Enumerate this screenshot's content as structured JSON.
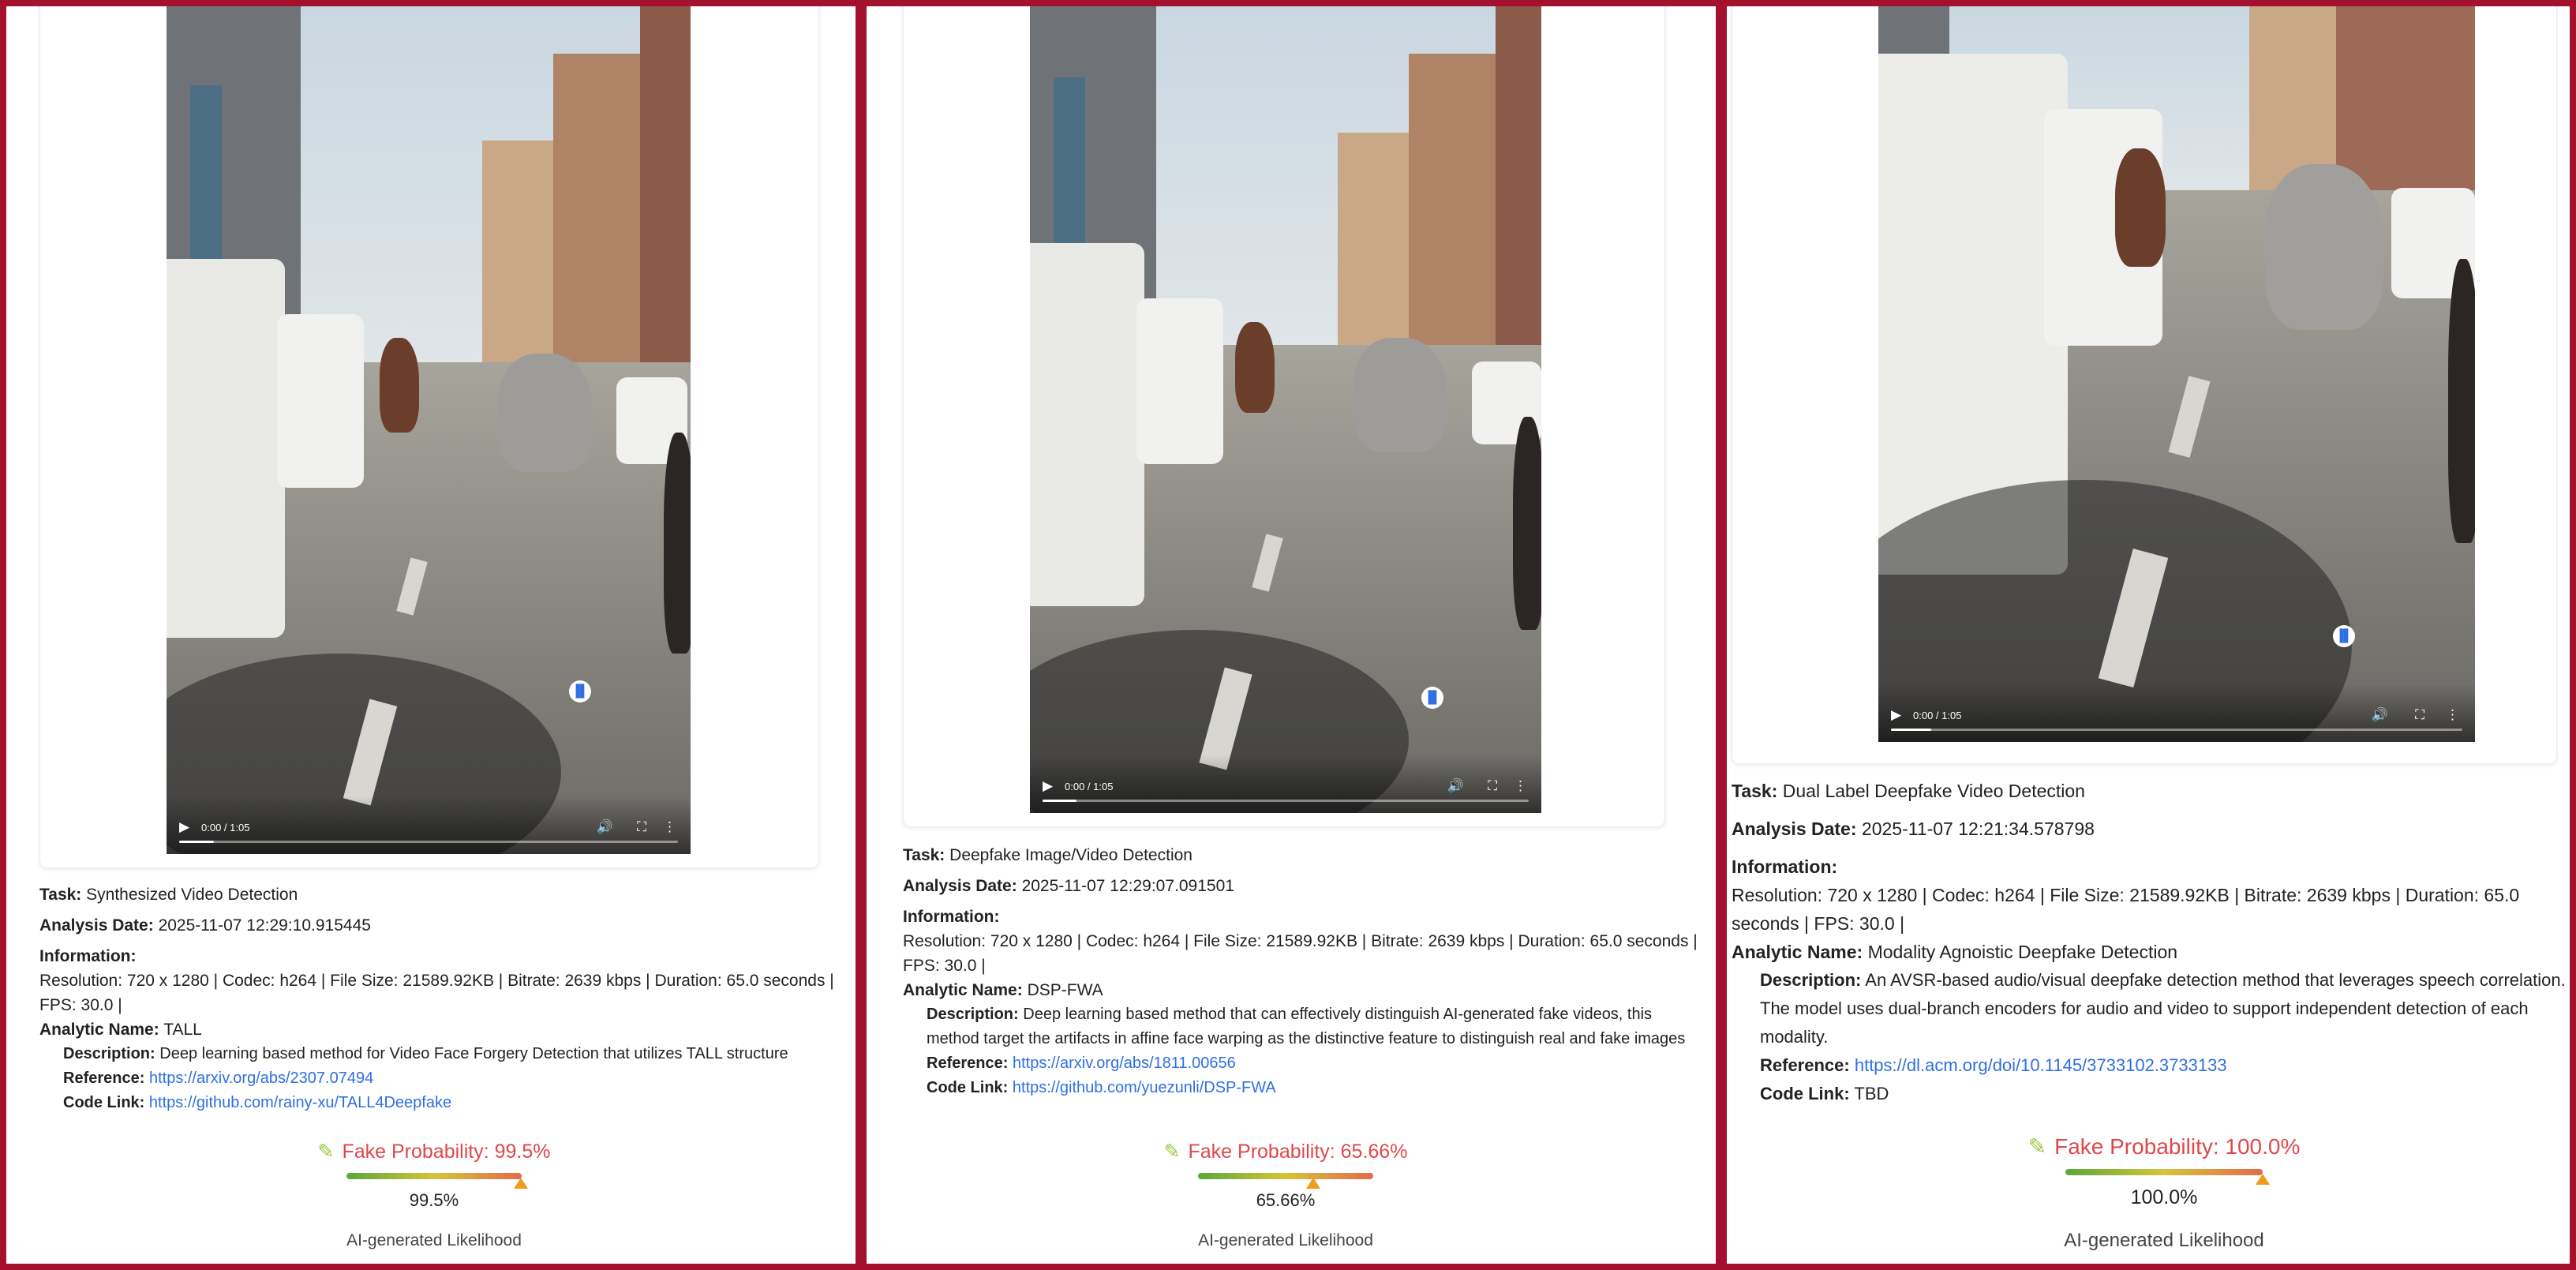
{
  "panels": [
    {
      "video": {
        "time": "0:00 / 1:05"
      },
      "task_label": "Task:",
      "task": "Synthesized Video Detection",
      "date_label": "Analysis Date:",
      "date": "2025-11-07 12:29:10.915445",
      "info_label": "Information:",
      "info": "Resolution: 720 x 1280 | Codec: h264 | File Size: 21589.92KB | Bitrate: 2639 kbps | Duration: 65.0 seconds | FPS: 30.0 |",
      "analytic_label": "Analytic Name:",
      "analytic": "TALL",
      "desc_label": "Description:",
      "desc": "Deep learning based method for Video Face Forgery Detection that utilizes TALL structure",
      "ref_label": "Reference:",
      "ref": "https://arxiv.org/abs/2307.07494",
      "code_label": "Code Link:",
      "code": "https://github.com/rainy-xu/TALL4Deepfake",
      "fake_title": "Fake Probability: 99.5%",
      "probability": 99.5,
      "pct": "99.5%",
      "footer": "AI-generated Likelihood"
    },
    {
      "video": {
        "time": "0:00 / 1:05"
      },
      "task_label": "Task:",
      "task": "Deepfake Image/Video Detection",
      "date_label": "Analysis Date:",
      "date": "2025-11-07 12:29:07.091501",
      "info_label": "Information:",
      "info": "Resolution: 720 x 1280 | Codec: h264 | File Size: 21589.92KB | Bitrate: 2639 kbps | Duration: 65.0 seconds | FPS: 30.0 |",
      "analytic_label": "Analytic Name:",
      "analytic": "DSP-FWA",
      "desc_label": "Description:",
      "desc": "Deep learning based method that can effectively distinguish AI-generated fake videos, this method target the artifacts in affine face warping as the distinctive feature to distinguish real and fake images",
      "ref_label": "Reference:",
      "ref": "https://arxiv.org/abs/1811.00656",
      "code_label": "Code Link:",
      "code": "https://github.com/yuezunli/DSP-FWA",
      "fake_title": "Fake Probability: 65.66%",
      "probability": 65.66,
      "pct": "65.66%",
      "footer": "AI-generated Likelihood"
    },
    {
      "video": {
        "time": "0:00 / 1:05"
      },
      "task_label": "Task:",
      "task": "Dual Label Deepfake Video Detection",
      "date_label": "Analysis Date:",
      "date": "2025-11-07 12:21:34.578798",
      "info_label": "Information:",
      "info": "Resolution: 720 x 1280 | Codec: h264 | File Size: 21589.92KB | Bitrate: 2639 kbps | Duration: 65.0 seconds | FPS: 30.0 |",
      "analytic_label": "Analytic Name:",
      "analytic": "Modality Agnoistic Deepfake Detection",
      "desc_label": "Description:",
      "desc": "An AVSR-based audio/visual deepfake detection method that leverages speech correlation. The model uses dual-branch encoders for audio and video to support independent detection of each modality.",
      "ref_label": "Reference:",
      "ref": "https://dl.acm.org/doi/10.1145/3733102.3733133",
      "code_label": "Code Link:",
      "code": "TBD",
      "fake_title": "Fake Probability: 100.0%",
      "probability": 100.0,
      "pct": "100.0%",
      "footer": "AI-generated Likelihood"
    }
  ],
  "icons": {
    "play": "play-icon",
    "volume": "volume-icon",
    "fullscreen": "fullscreen-icon",
    "more": "more-options-icon",
    "audio": "audio-wave-icon",
    "meter": "pen-icon"
  },
  "colors": {
    "frame": "#a3112f",
    "fake_title": "#e0474c",
    "link": "#2f6fe0",
    "gauge_low": "#5aa83a",
    "gauge_mid": "#d6c43a",
    "gauge_high": "#e26a4c",
    "marker": "#f29a1a"
  }
}
